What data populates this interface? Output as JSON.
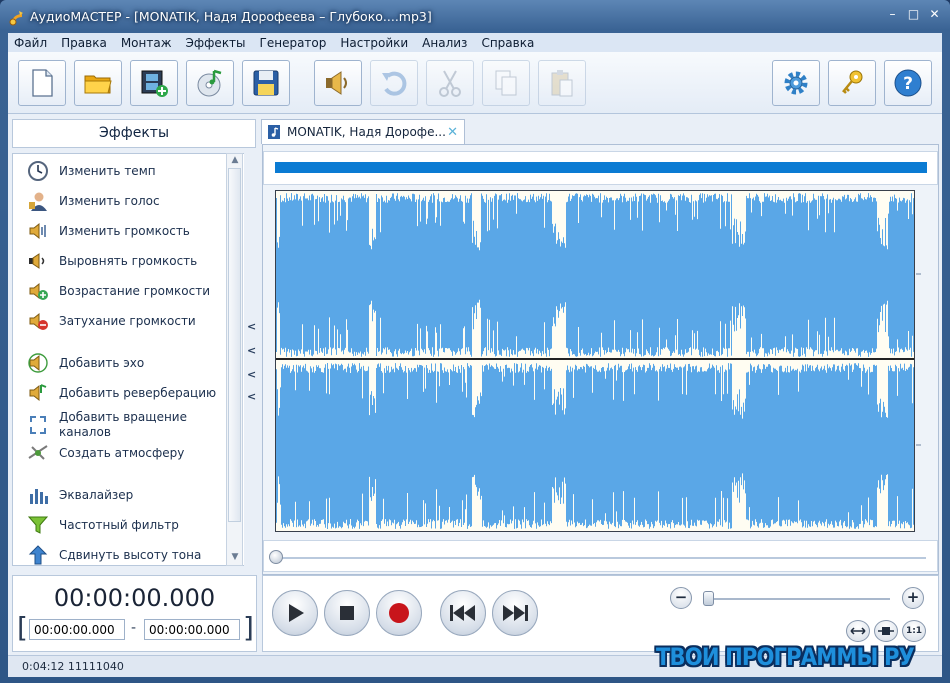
{
  "window": {
    "title": "АудиоМАСТЕР - [MONATIK, Надя Дорофеева – Глубоко....mp3]",
    "controls": [
      "–",
      "□",
      "✕"
    ]
  },
  "menu": [
    "Файл",
    "Правка",
    "Монтаж",
    "Эффекты",
    "Генератор",
    "Настройки",
    "Анализ",
    "Справка"
  ],
  "toolbar": {
    "buttons": [
      {
        "name": "new-file",
        "icon": "new-file-icon",
        "enabled": true
      },
      {
        "name": "open-folder",
        "icon": "folder-icon",
        "enabled": true
      },
      {
        "name": "open-video",
        "icon": "film-add-icon",
        "enabled": true
      },
      {
        "name": "cd-grab",
        "icon": "cd-music-icon",
        "enabled": true
      },
      {
        "name": "save",
        "icon": "floppy-icon",
        "enabled": true
      },
      {
        "name": "record-voice",
        "icon": "speaker-icon",
        "enabled": true
      },
      {
        "name": "undo",
        "icon": "undo-icon",
        "enabled": false
      },
      {
        "name": "cut",
        "icon": "scissors-icon",
        "enabled": false
      },
      {
        "name": "copy",
        "icon": "copy-icon",
        "enabled": false
      },
      {
        "name": "paste",
        "icon": "paste-icon",
        "enabled": false
      },
      {
        "name": "settings",
        "icon": "gear-icon",
        "enabled": true
      },
      {
        "name": "activation",
        "icon": "keys-icon",
        "enabled": true
      },
      {
        "name": "help",
        "icon": "help-icon",
        "enabled": true
      }
    ]
  },
  "effects": {
    "header": "Эффекты",
    "items": [
      {
        "label": "Изменить темп",
        "icon": "clock-icon"
      },
      {
        "label": "Изменить голос",
        "icon": "person-icon"
      },
      {
        "label": "Изменить громкость",
        "icon": "volume-icon"
      },
      {
        "label": "Выровнять громкость",
        "icon": "normalize-icon"
      },
      {
        "label": "Возрастание громкости",
        "icon": "fade-in-icon"
      },
      {
        "label": "Затухание громкости",
        "icon": "fade-out-icon"
      },
      {
        "label": "Добавить эхо",
        "icon": "echo-icon"
      },
      {
        "label": "Добавить реверберацию",
        "icon": "reverb-icon"
      },
      {
        "label": "Добавить вращение каналов",
        "icon": "rotate-icon"
      },
      {
        "label": "Создать атмосферу",
        "icon": "atmosphere-icon"
      },
      {
        "label": "Эквалайзер",
        "icon": "equalizer-icon"
      },
      {
        "label": "Частотный фильтр",
        "icon": "filter-icon"
      },
      {
        "label": "Сдвинуть высоту тона",
        "icon": "pitch-icon"
      }
    ]
  },
  "time": {
    "current": "00:00:00.000",
    "start": "00:00:00.000",
    "end": "00:00:00.000"
  },
  "tab": {
    "label": "MONATIK, Надя Дорофе...",
    "close": "✕"
  },
  "zoom": {
    "level": 0.02,
    "minus": "−",
    "plus": "+",
    "fit_label": "1:1"
  },
  "status": {
    "text": "0:04:12  11111040"
  },
  "watermark": "ТВОИ ПРОГРАММЫ РУ",
  "colors": {
    "waveform": "#5aa7e7",
    "overview": "#0b7bd3",
    "record": "#c8151b"
  }
}
